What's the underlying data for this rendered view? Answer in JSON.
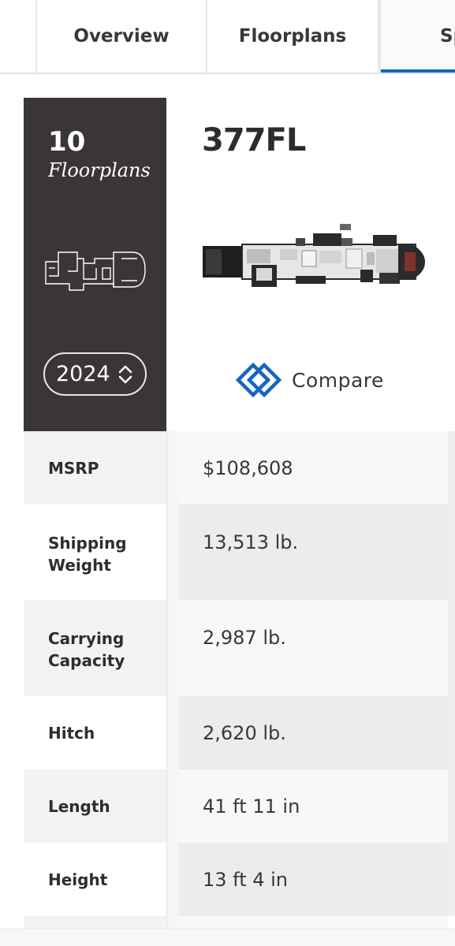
{
  "tabs": [
    {
      "label": ""
    },
    {
      "label": "Overview"
    },
    {
      "label": "Floorplans"
    },
    {
      "label": "Specs"
    }
  ],
  "sidebar": {
    "count": "10",
    "label": "Floorplans",
    "icon": "floorplan-outline-icon",
    "year": "2024"
  },
  "floorplan": {
    "title": "377FL",
    "image": "floorplan-diagram",
    "compare_label": "Compare",
    "compare_icon": "compare-diamond-icon"
  },
  "specs": [
    {
      "label": "MSRP",
      "value": "$108,608"
    },
    {
      "label": "Shipping Weight",
      "value": "13,513 lb."
    },
    {
      "label": "Carrying Capacity",
      "value": "2,987 lb."
    },
    {
      "label": "Hitch",
      "value": "2,620 lb."
    },
    {
      "label": "Length",
      "value": "41 ft 11 in"
    },
    {
      "label": "Height",
      "value": "13 ft 4 in"
    }
  ],
  "colors": {
    "accent": "#1565c0",
    "card": "#3a3638",
    "text": "#2f2c2d"
  }
}
